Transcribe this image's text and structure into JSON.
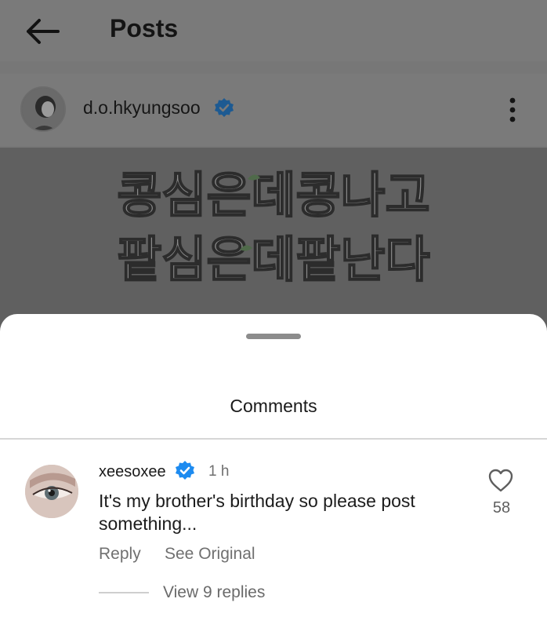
{
  "header": {
    "title": "Posts",
    "back_icon": "arrow-left-icon"
  },
  "post": {
    "author": "d.o.hkyungsoo",
    "verified_icon": "verified-badge-icon",
    "more_icon": "more-vertical-icon",
    "image_lines": [
      "콩심은데콩나고",
      "팥심은데팥난다"
    ]
  },
  "comments_sheet": {
    "title": "Comments",
    "comment": {
      "username": "xeesoxee",
      "time": "1 h",
      "text": "It's my brother's birthday so please post something...",
      "reply_label": "Reply",
      "see_original_label": "See Original",
      "likes": "58",
      "like_icon": "heart-outline-icon",
      "view_replies_label": "View 9 replies"
    }
  },
  "colors": {
    "verified": "#1d8bf0",
    "overlay_gray": "#7a7a7a"
  }
}
